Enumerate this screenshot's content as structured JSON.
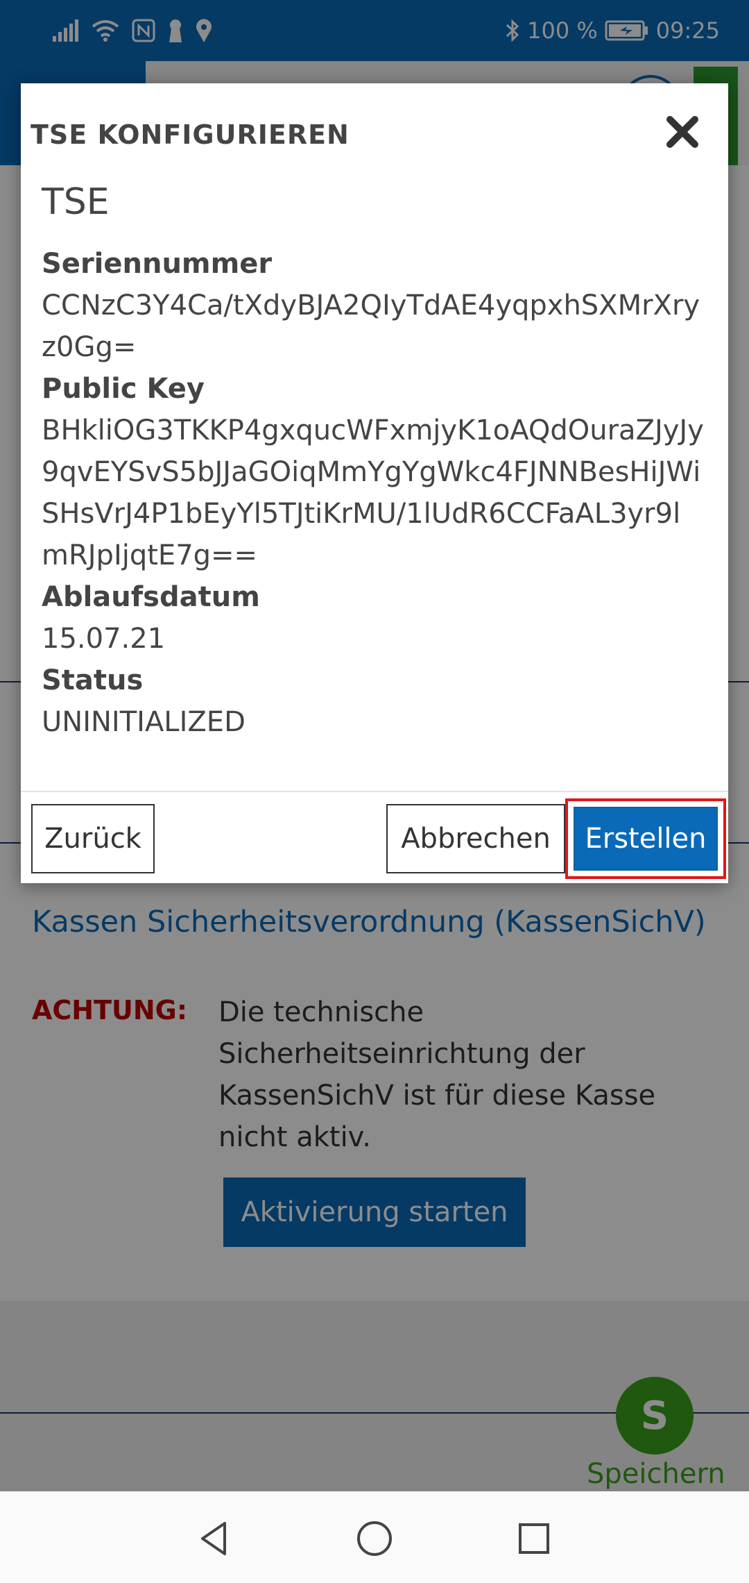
{
  "status_bar": {
    "battery": "100 %",
    "time": "09:25",
    "icons": [
      "signal-icon",
      "wifi-icon",
      "nfc-icon",
      "keyhole-icon",
      "location-icon",
      "bluetooth-icon",
      "battery-icon"
    ]
  },
  "background": {
    "section_title": "Kassen Sicherheitsverordnung (KassenSichV)",
    "warning_label": "ACHTUNG:",
    "warning_text": "Die technische Sicherheitseinrichtung der KassenSichV ist für diese Kasse nicht aktiv.",
    "activate_button": "Aktivierung starten",
    "save_initial": "S",
    "save_label": "Speichern"
  },
  "modal": {
    "title": "TSE KONFIGURIEREN",
    "tse_name": "TSE",
    "fields": [
      {
        "label": "Seriennummer",
        "value": "CCNzC3Y4Ca/tXdyBJA2QIyTdAE4yqpxhSXMrXryz0Gg="
      },
      {
        "label": "Public Key",
        "value": "BHkliOG3TKKP4gxqucWFxmjyK1oAQdOuraZJyJy9qvEYSvS5bJJaGOiqMmYgYgWkc4FJNNBesHiJWiSHsVrJ4P1bEyYl5TJtiKrMU/1lUdR6CCFaAL3yr9lmRJpIjqtE7g=="
      },
      {
        "label": "Ablaufsdatum",
        "value": "15.07.21"
      },
      {
        "label": "Status",
        "value": "UNINITIALIZED"
      }
    ],
    "buttons": {
      "back": "Zurück",
      "cancel": "Abbrechen",
      "create": "Erstellen"
    }
  },
  "colors": {
    "brand_blue": "#0a6ab8",
    "warning_red": "#c00000",
    "save_green": "#3aa01a",
    "highlight_red": "#e0161b"
  }
}
